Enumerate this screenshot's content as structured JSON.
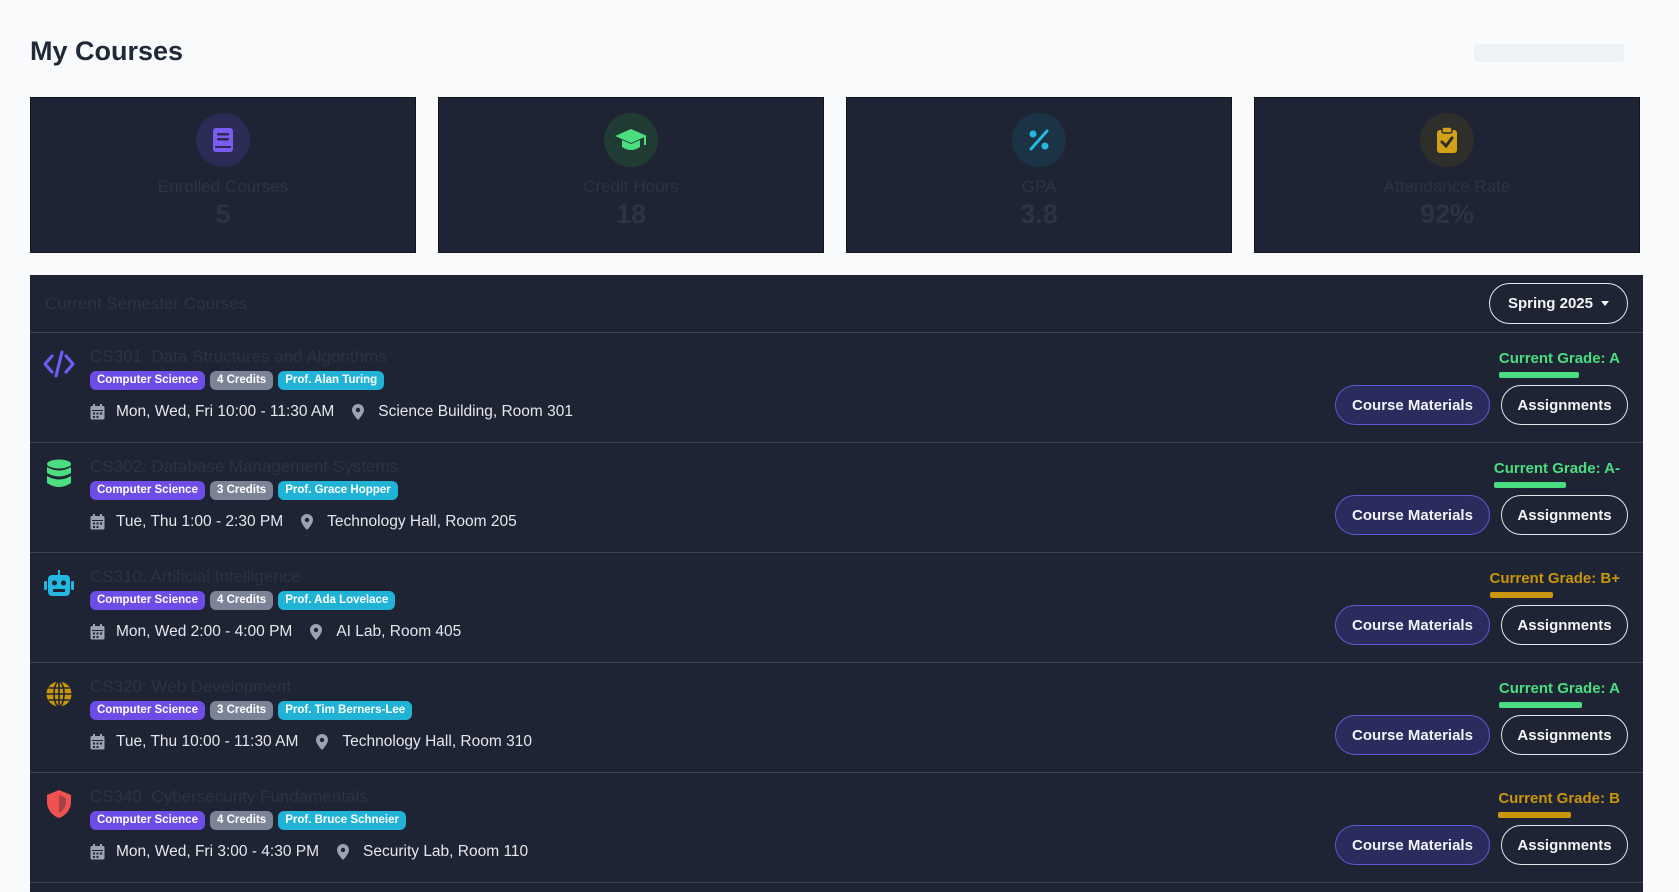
{
  "page": {
    "title": "My Courses"
  },
  "stats": [
    {
      "label": "Enrolled Courses",
      "value": "5",
      "icon": "book-icon",
      "color": "#7c5cf0",
      "bg": "#2b2b55"
    },
    {
      "label": "Credit Hours",
      "value": "18",
      "icon": "graduation-cap-icon",
      "color": "#4ade80",
      "bg": "#1f3b34"
    },
    {
      "label": "GPA",
      "value": "3.8",
      "icon": "percent-icon",
      "color": "#22b8e0",
      "bg": "#1c3346"
    },
    {
      "label": "Attendance Rate",
      "value": "92%",
      "icon": "clipboard-check-icon",
      "color": "#d4a017",
      "bg": "#2e2e2a"
    }
  ],
  "courses_panel": {
    "title": "Current Semester Courses",
    "semester": "Spring 2025"
  },
  "buttons": {
    "materials": "Course Materials",
    "assignments": "Assignments"
  },
  "courses": [
    {
      "title": "CS301: Data Structures and Algorithms",
      "icon": "code-icon",
      "icon_color": "#6d5cf0",
      "department": "Computer Science",
      "credits": "4 Credits",
      "professor": "Prof. Alan Turing",
      "schedule": "Mon, Wed, Fri 10:00 - 11:30 AM",
      "location": "Science Building, Room 301",
      "grade": "Current Grade: A",
      "grade_color": "#4ade80",
      "grade_fraction": 0.7
    },
    {
      "title": "CS302: Database Management Systems",
      "icon": "database-icon",
      "icon_color": "#4ade80",
      "department": "Computer Science",
      "credits": "3 Credits",
      "professor": "Prof. Grace Hopper",
      "schedule": "Tue, Thu 1:00 - 2:30 PM",
      "location": "Technology Hall, Room 205",
      "grade": "Current Grade: A-",
      "grade_color": "#4ade80",
      "grade_fraction": 0.63
    },
    {
      "title": "CS310: Artificial Intelligence",
      "icon": "robot-icon",
      "icon_color": "#22b8e0",
      "department": "Computer Science",
      "credits": "4 Credits",
      "professor": "Prof. Ada Lovelace",
      "schedule": "Mon, Wed 2:00 - 4:00 PM",
      "location": "AI Lab, Room 405",
      "grade": "Current Grade: B+",
      "grade_color": "#c9960c",
      "grade_fraction": 0.55
    },
    {
      "title": "CS320: Web Development",
      "icon": "globe-icon",
      "icon_color": "#c9960c",
      "department": "Computer Science",
      "credits": "3 Credits",
      "professor": "Prof. Tim Berners-Lee",
      "schedule": "Tue, Thu 10:00 - 11:30 AM",
      "location": "Technology Hall, Room 310",
      "grade": "Current Grade: A",
      "grade_color": "#4ade80",
      "grade_fraction": 0.72
    },
    {
      "title": "CS340: Cybersecurity Fundamentals",
      "icon": "shield-icon",
      "icon_color": "#f05252",
      "department": "Computer Science",
      "credits": "4 Credits",
      "professor": "Prof. Bruce Schneier",
      "schedule": "Mon, Wed, Fri 3:00 - 4:30 PM",
      "location": "Security Lab, Room 110",
      "grade": "Current Grade: B",
      "grade_color": "#c9960c",
      "grade_fraction": 0.63
    }
  ]
}
